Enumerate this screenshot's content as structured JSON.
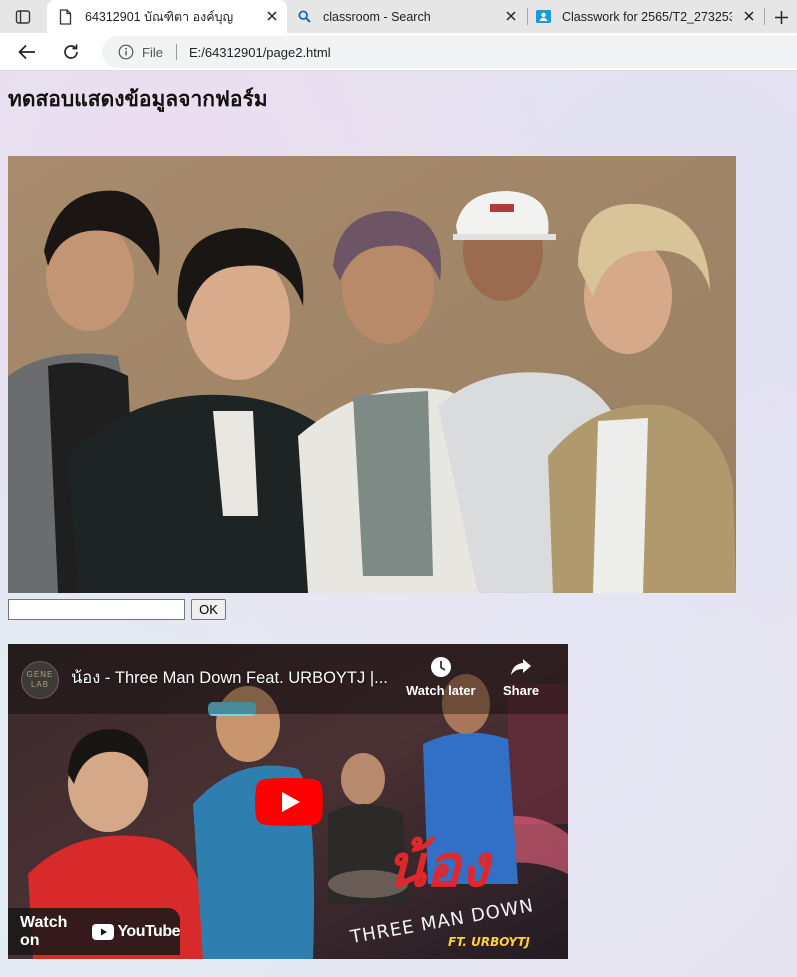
{
  "browser": {
    "tabs": [
      {
        "title": "64312901 บัณฑิตา องค์บุญ",
        "icon": "document-icon",
        "active": true
      },
      {
        "title": "classroom - Search",
        "icon": "search-icon",
        "active": false
      },
      {
        "title": "Classwork for 2565/T2_273253_Ir",
        "icon": "classroom-icon",
        "active": false
      }
    ],
    "address": {
      "scheme_label": "File",
      "url": "E:/64312901/page2.html"
    }
  },
  "page": {
    "heading": "ทดสอบแสดงข้อมูลจากฟอร์ม",
    "form": {
      "input_value": "",
      "ok_label": "OK"
    },
    "video": {
      "channel_logo_line1": "GENE",
      "channel_logo_line2": "LAB",
      "title": "น้อง - Three Man Down Feat. URBOYTJ |...",
      "watch_later_label": "Watch later",
      "share_label": "Share",
      "watch_on_label": "Watch on",
      "youtube_label": "YouTube",
      "thumb_title_art": "น้อง",
      "thumb_band_art": "THREE MAN DOWN",
      "thumb_feat_art": "FT. URBOYTJ"
    }
  },
  "colors": {
    "youtube_red": "#ff0000",
    "tab_strip": "#e6e6e6",
    "omnibox": "#f1f3f4"
  }
}
